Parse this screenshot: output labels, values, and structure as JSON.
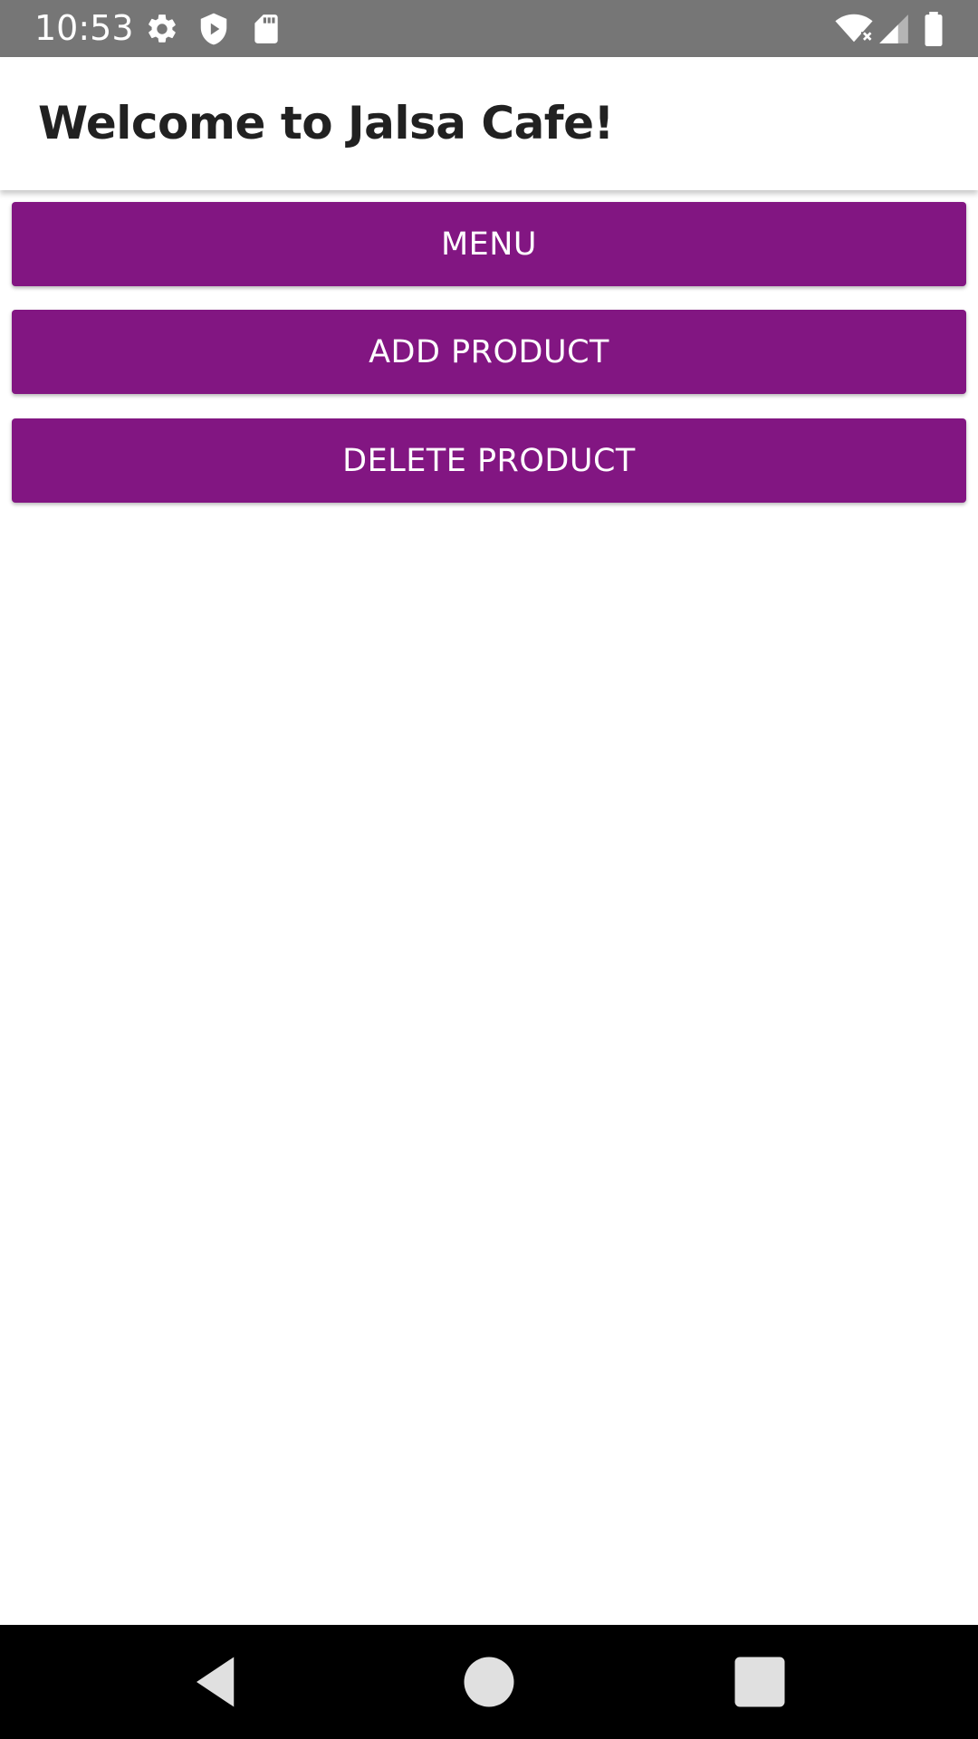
{
  "status_bar": {
    "time": "10:53",
    "icons_left": [
      "gear-icon",
      "shield-icon",
      "sd-card-icon"
    ],
    "icons_right": [
      "wifi-icon",
      "signal-icon",
      "battery-icon"
    ],
    "background": "#767676"
  },
  "app_bar": {
    "title": "Welcome to Jalsa Cafe!"
  },
  "buttons": {
    "menu_label": "MENU",
    "add_product_label": "ADD PRODUCT",
    "delete_product_label": "DELETE PRODUCT",
    "color": "#821682"
  },
  "nav_bar": {
    "buttons": [
      "back-icon",
      "home-icon",
      "recents-icon"
    ]
  }
}
